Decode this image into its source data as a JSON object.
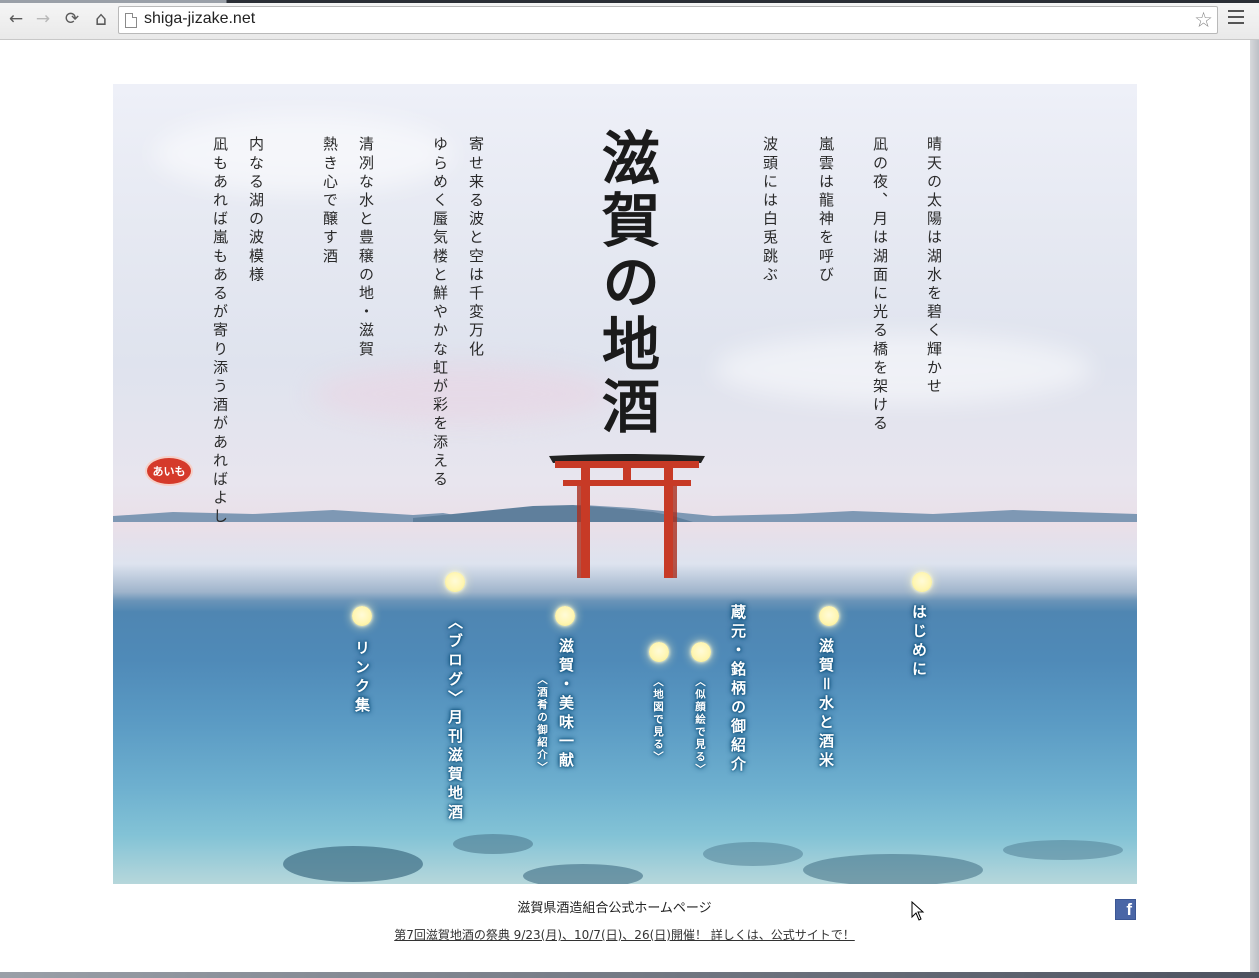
{
  "browser": {
    "url": "shiga-jizake.net",
    "back_icon": "←",
    "forward_icon": "→",
    "reload_icon": "⟳",
    "home_icon": "⌂",
    "star_icon": "☆"
  },
  "hero": {
    "title": "滋賀の地酒",
    "poem": [
      "晴天の太陽は湖水を碧く輝かせ",
      "凪の夜、月は湖面に光る橋を架ける",
      "嵐雲は龍神を呼び",
      "波頭には白兎跳ぶ",
      "寄せ来る波と空は千変万化",
      "ゆらめく蜃気楼と鮮やかな虹が彩を添える",
      "清冽な水と豊穣の地・滋賀",
      "熱き心で醸す酒",
      "内なる湖の波模様",
      "凪もあれば嵐もあるが寄り添う酒があればよし"
    ],
    "stamp_text": "あいも"
  },
  "menu": {
    "hajimeni": "はじめに",
    "mizu_sakamai": "滋賀＝水と酒米",
    "kuramoto": "蔵元・銘柄の御紹介",
    "nigaoe": "〈似顔絵で見る〉",
    "chizu": "〈地図で見る〉",
    "bimi": "滋賀・美味一献",
    "bimi_sub": "〈酒肴の御紹介〉",
    "blog": "〈ブログ〉月刊滋賀地酒",
    "links": "リンク集"
  },
  "footer": {
    "title": "滋賀県酒造組合公式ホームページ",
    "event_link": "第7回滋賀地酒の祭典  9/23(月)、10/7(日)、26(日)開催！  詳しくは、公式サイトで！",
    "facebook_letter": "f"
  },
  "colors": {
    "menu_dot": "#fff6b3",
    "torii": "#c73a26",
    "stamp": "#d53a2a",
    "facebook": "#4a66a6"
  }
}
